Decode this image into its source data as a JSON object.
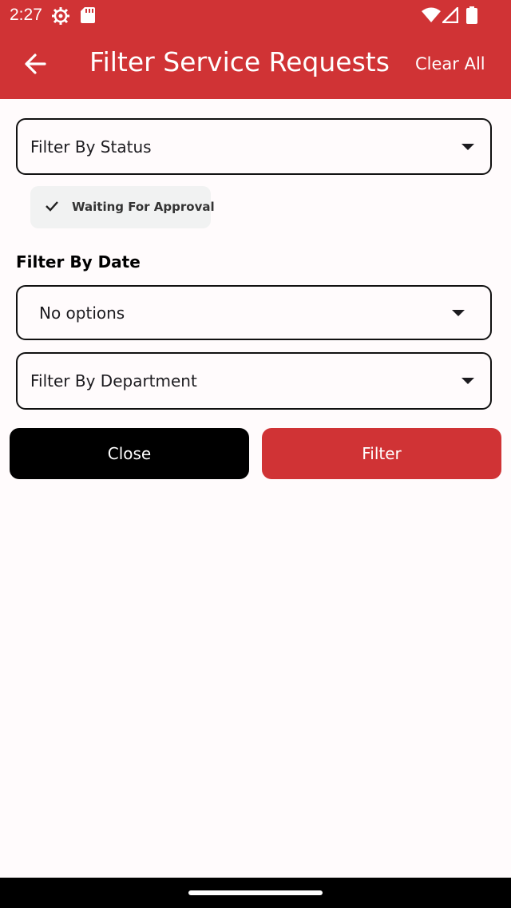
{
  "status_bar": {
    "time": "2:27"
  },
  "header": {
    "title": "Filter Service Requests",
    "clear_all_label": "Clear All"
  },
  "filters": {
    "status_dropdown": {
      "label": "Filter By Status"
    },
    "status_chips": [
      {
        "label": "Waiting For Approval",
        "selected": true
      }
    ],
    "date_section_label": "Filter By Date",
    "date_dropdown": {
      "label": "No options"
    },
    "department_dropdown": {
      "label": "Filter By Department"
    }
  },
  "actions": {
    "close_label": "Close",
    "filter_label": "Filter"
  },
  "colors": {
    "primary": "#d03335",
    "close_button": "#000000",
    "chip_background": "#f1f2f2",
    "background": "#fffbfc"
  }
}
